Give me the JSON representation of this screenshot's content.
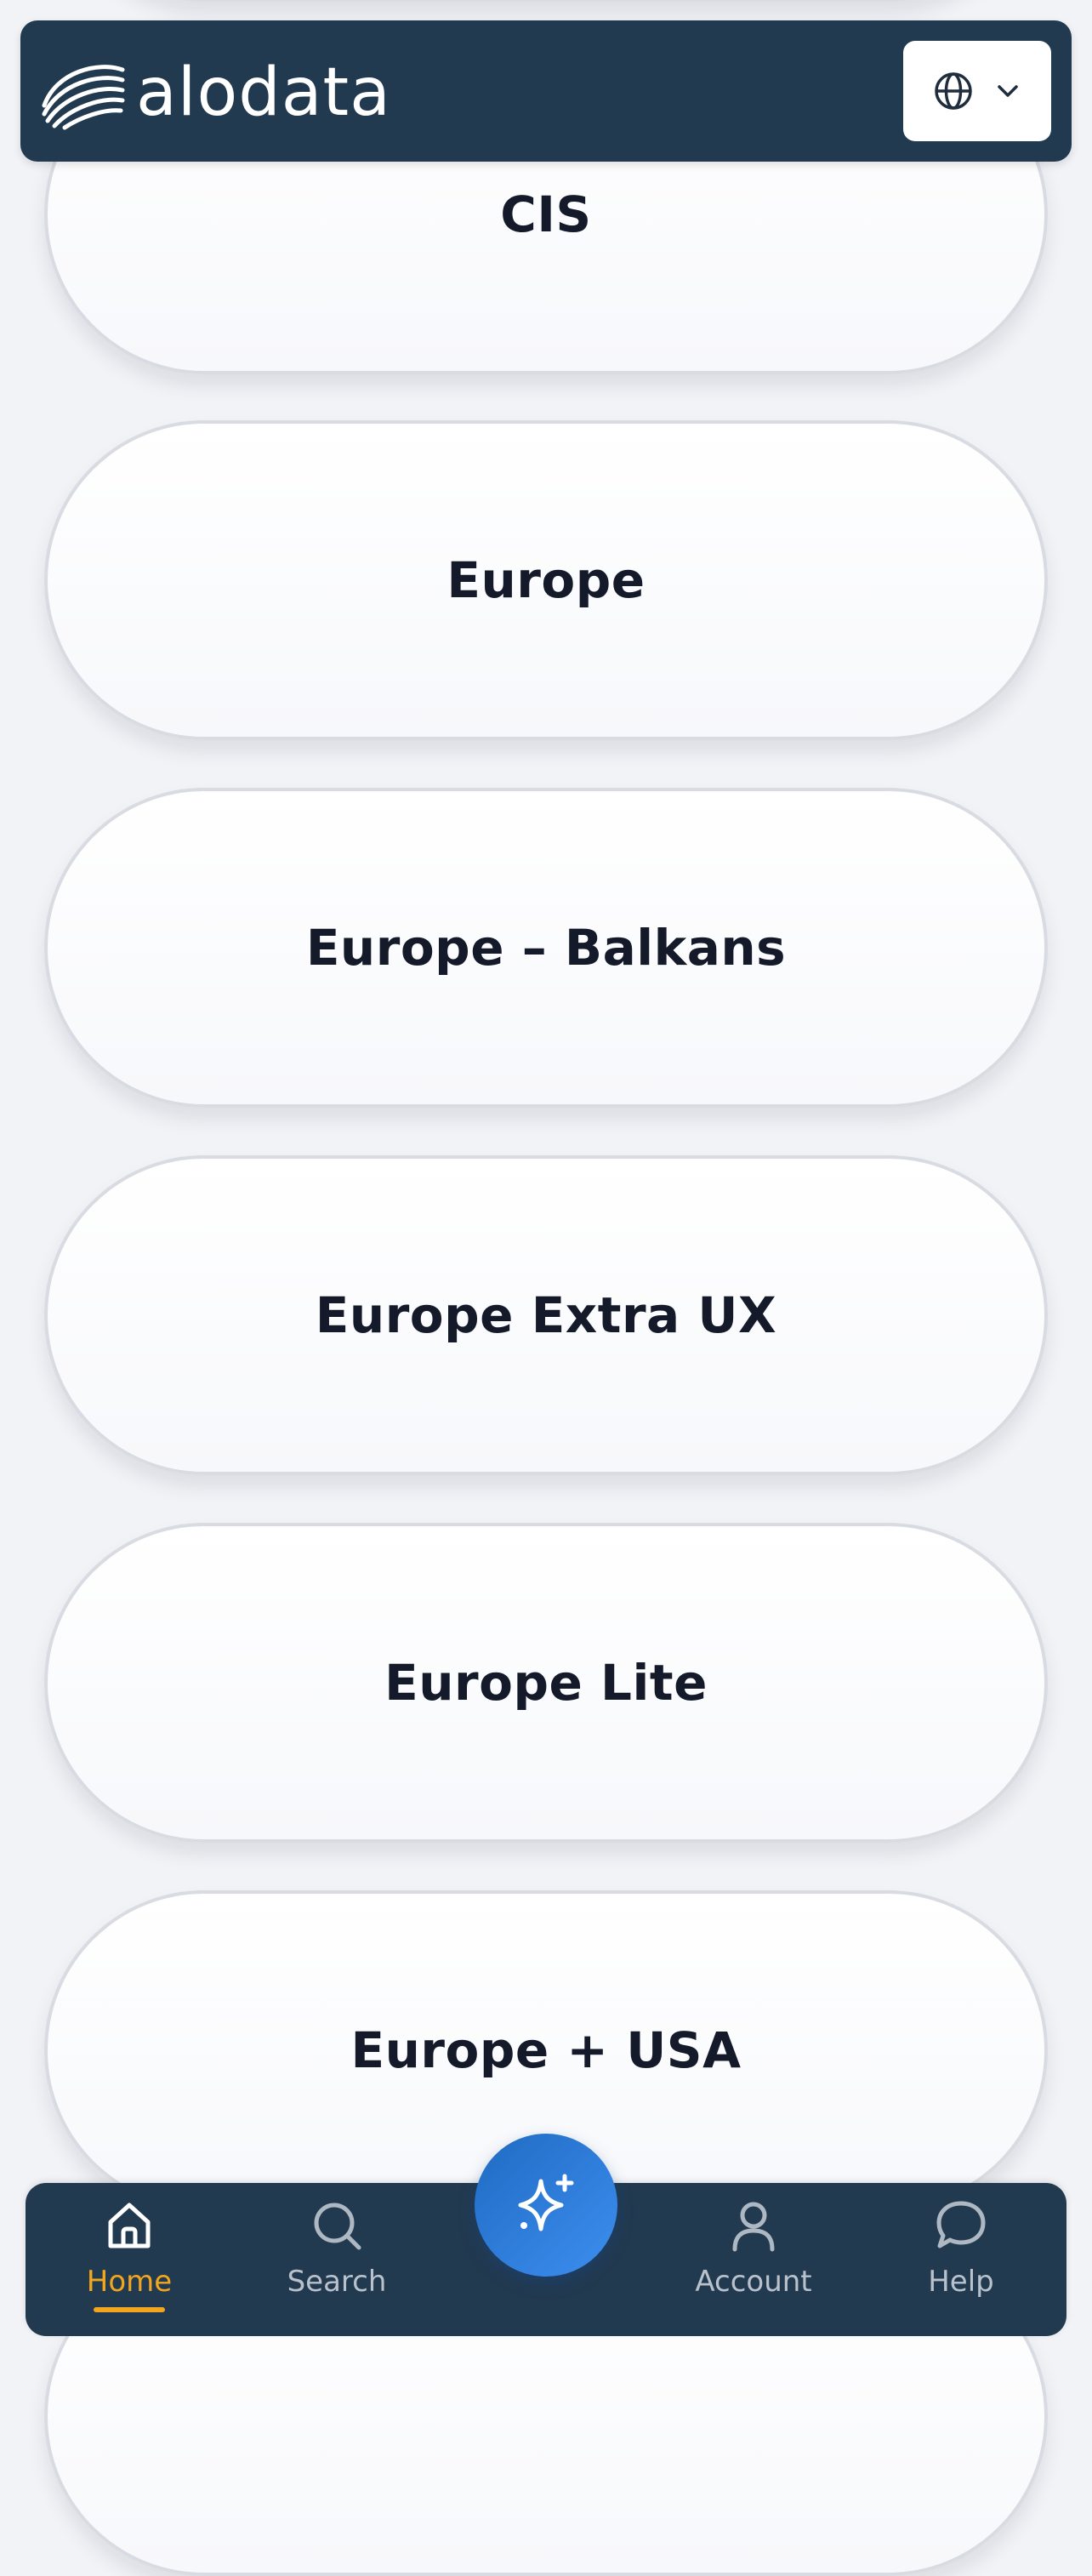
{
  "header": {
    "logo_text": "alodata",
    "language_icon": "globe-icon",
    "dropdown_icon": "chevron-down-icon"
  },
  "regions": [
    {
      "label": ""
    },
    {
      "label": "CIS"
    },
    {
      "label": "Europe"
    },
    {
      "label": "Europe – Balkans"
    },
    {
      "label": "Europe Extra UX"
    },
    {
      "label": "Europe Lite"
    },
    {
      "label": "Europe + USA"
    },
    {
      "label": ""
    }
  ],
  "nav": {
    "items": [
      {
        "label": "Home",
        "icon": "home-icon",
        "active": true
      },
      {
        "label": "Search",
        "icon": "search-icon",
        "active": false
      },
      {
        "label": "Account",
        "icon": "user-icon",
        "active": false
      },
      {
        "label": "Help",
        "icon": "chat-bubble-icon",
        "active": false
      }
    ],
    "fab_icon": "sparkle-icon"
  },
  "colors": {
    "header_bg": "#223a50",
    "accent": "#f2a51e",
    "fab": "#2f7fdf",
    "background": "#f2f3f7"
  }
}
